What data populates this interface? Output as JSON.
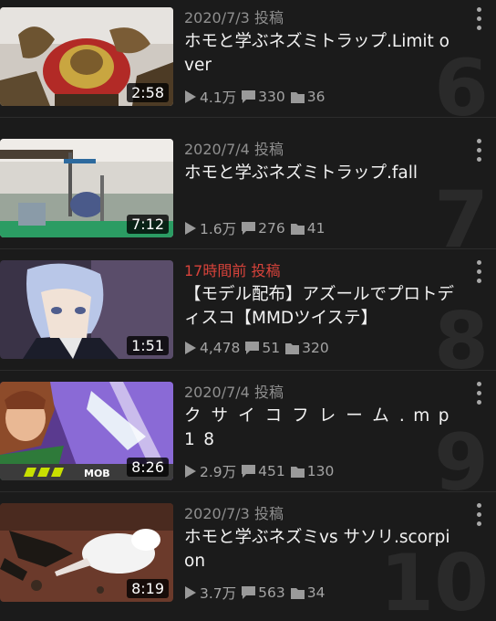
{
  "videos": [
    {
      "date": "2020/7/3 投稿",
      "title": "ホモと学ぶネズミトラップ.Limit over",
      "duration": "2:58",
      "views": "4.1万",
      "comments": "330",
      "mylists": "36",
      "rank": "6",
      "recent": false
    },
    {
      "date": "2020/7/4 投稿",
      "title": "ホモと学ぶネズミトラップ.fall",
      "duration": "7:12",
      "views": "1.6万",
      "comments": "276",
      "mylists": "41",
      "rank": "7",
      "recent": false
    },
    {
      "date": "17時間前 投稿",
      "title": "【モデル配布】アズールでプロトディスコ【MMDツイステ】",
      "duration": "1:51",
      "views": "4,478",
      "comments": "51",
      "mylists": "320",
      "rank": "8",
      "recent": true
    },
    {
      "date": "2020/7/4 投稿",
      "title": "クサイコフレーム.mp18",
      "duration": "8:26",
      "views": "2.9万",
      "comments": "451",
      "mylists": "130",
      "rank": "9",
      "recent": false
    },
    {
      "date": "2020/7/3 投稿",
      "title": "ホモと学ぶネズミvs サソリ.scorpion",
      "duration": "8:19",
      "views": "3.7万",
      "comments": "563",
      "mylists": "34",
      "rank": "10",
      "recent": false
    }
  ],
  "thumb_overlay_text": {
    "mobile_logo": "MOB"
  },
  "icons": {
    "views": "play-icon",
    "comments": "comment-icon",
    "mylists": "folder-icon",
    "menu": "more-vertical-icon"
  },
  "colors": {
    "background": "#1b1b1b",
    "recent_date": "#d8433b",
    "meta": "#8f8f8f",
    "rank_number": "#2a2a2a"
  }
}
